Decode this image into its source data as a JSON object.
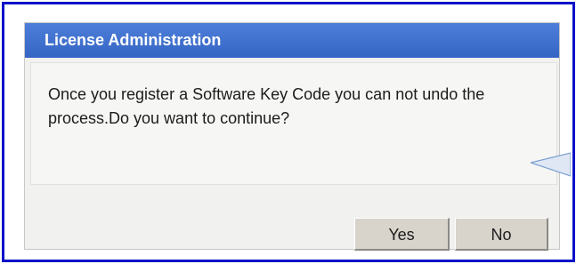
{
  "dialog": {
    "title": "License Administration",
    "message": "Once you register a Software Key Code you can not undo the process.Do you want to continue?",
    "yes_label": "Yes",
    "no_label": "No"
  },
  "colors": {
    "frame_border": "#0a12c8",
    "titlebar": "#3f6fd0",
    "dialog_bg": "#f1f1ef",
    "button_bg": "#d8d3cb"
  }
}
